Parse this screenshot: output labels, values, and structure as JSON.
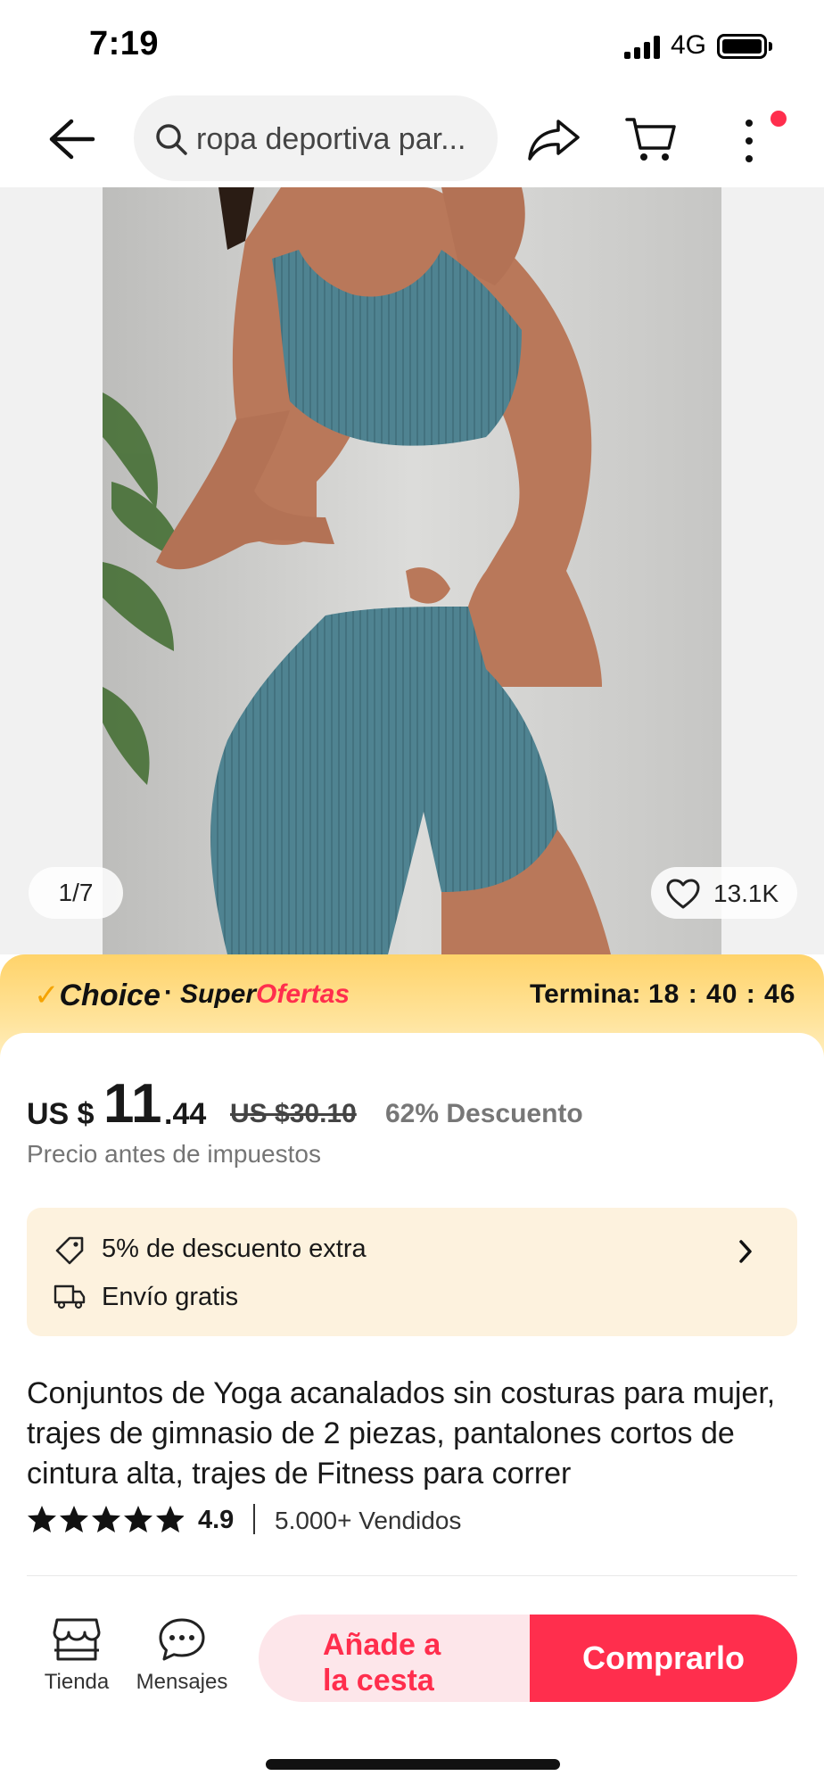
{
  "status_bar": {
    "time": "7:19",
    "network": "4G"
  },
  "nav": {
    "search_text": "ropa deportiva par..."
  },
  "gallery": {
    "page_counter": "1/7",
    "wishlist_count": "13.1K",
    "image_count_current": 1,
    "image_count_total": 7
  },
  "promo": {
    "choice_check": "✓",
    "choice_label": "Choice",
    "separator": "·",
    "super_prefix": "Super",
    "super_suffix": "Ofertas",
    "ends_label": "Termina:",
    "ends_time": "18 : 40 : 46"
  },
  "price": {
    "currency": "US $",
    "integer": "11",
    "decimal": ".44",
    "original": "US $30.10",
    "discount": "62% Descuento",
    "tax_note": "Precio antes de impuestos"
  },
  "coupon": {
    "extra_discount": "5% de descuento extra",
    "shipping": "Envío gratis"
  },
  "product": {
    "title": "Conjuntos de Yoga acanalados sin costuras para mujer, trajes de gimnasio de 2 piezas, pantalones cortos de cintura alta, trajes de Fitness para correr",
    "rating": "4.9",
    "rating_stars": 5,
    "sold": "5.000+ Vendidos"
  },
  "bottom_bar": {
    "store_label": "Tienda",
    "messages_label": "Mensajes",
    "add_to_cart_line1": "Añade a",
    "add_to_cart_line2": "la cesta",
    "buy_label": "Comprarlo"
  },
  "colors": {
    "accent": "#ff2e4d",
    "promo_gold": "#ffd36a",
    "coupon_bg": "#fdf2de",
    "product_teal": "#4f8391"
  }
}
